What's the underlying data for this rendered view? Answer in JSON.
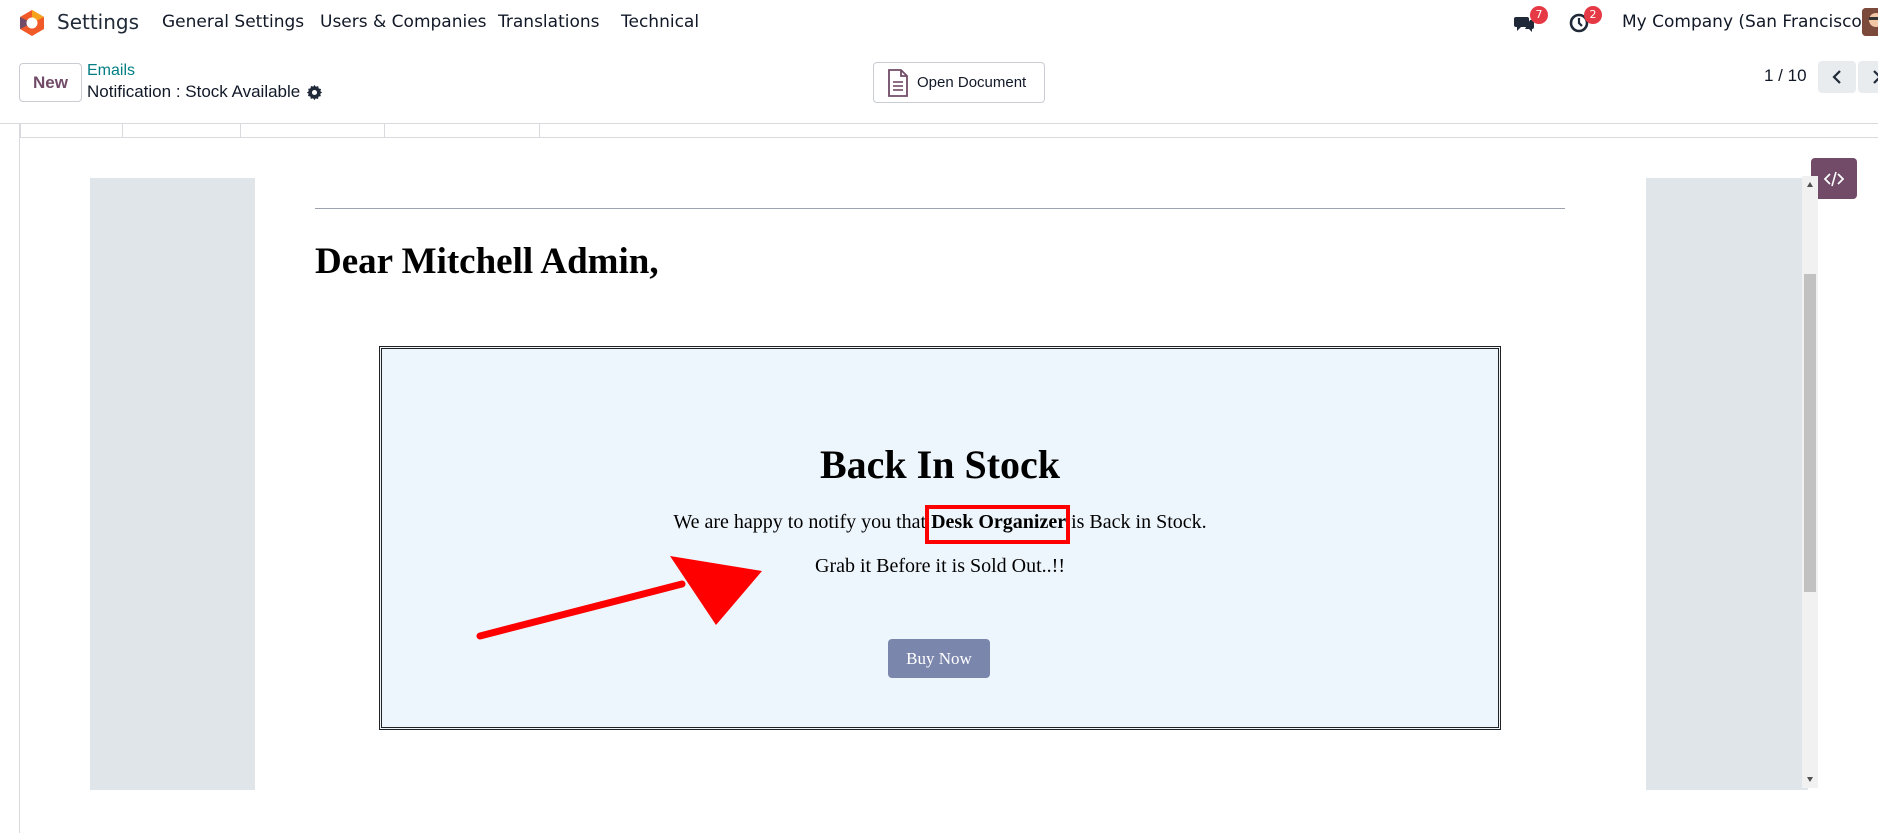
{
  "navbar": {
    "app_name": "Settings",
    "menu": [
      "General Settings",
      "Users & Companies",
      "Translations",
      "Technical"
    ],
    "messages_count": "7",
    "activities_count": "2",
    "company": "My Company (San Francisco)"
  },
  "control_panel": {
    "new_label": "New",
    "breadcrumb": "Emails",
    "record_title": "Notification : Stock Available",
    "open_document_label": "Open Document",
    "pager": "1 / 10"
  },
  "email": {
    "greeting": "Dear Mitchell Admin,",
    "box_title": "Back In Stock",
    "line_prefix": "We are happy to notify you that",
    "product": "Desk Organizer",
    "line_suffix": "is Back in Stock.",
    "sub_line": "Grab it Before it is Sold Out..!!",
    "button_label": "Buy Now"
  },
  "colors": {
    "brand": "#714b67",
    "link": "#017e84",
    "badge": "#e63946",
    "annotation": "#ff0000",
    "box_bg": "#eef6fd",
    "button": "#7b86ad"
  },
  "icons": [
    "odoo-logo-icon",
    "chat-icon",
    "clock-icon",
    "gear-icon",
    "document-icon",
    "chevron-left-icon",
    "chevron-right-icon",
    "code-icon"
  ]
}
